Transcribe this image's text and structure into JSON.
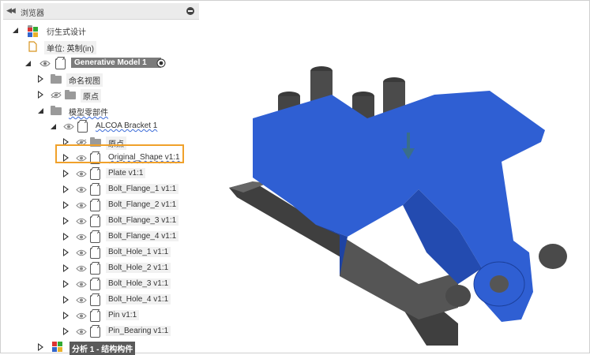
{
  "browser": {
    "collapse_glyph": "◀◀",
    "title": "浏览器",
    "root": "衍生式设计",
    "units": "单位: 英制(in)",
    "model": "Generative Model 1",
    "items": [
      {
        "label": "命名视图",
        "indent": 2
      },
      {
        "label": "原点",
        "indent": 2
      },
      {
        "label": "模型零部件",
        "indent": 2
      },
      {
        "label": "ALCOA Bracket 1",
        "indent": 3
      },
      {
        "label": "原点",
        "indent": 4
      },
      {
        "label": "Original_Shape v1:1",
        "indent": 4
      },
      {
        "label": "Plate v1:1",
        "indent": 4
      },
      {
        "label": "Bolt_Flange_1 v1:1",
        "indent": 4
      },
      {
        "label": "Bolt_Flange_2 v1:1",
        "indent": 4
      },
      {
        "label": "Bolt_Flange_3 v1:1",
        "indent": 4
      },
      {
        "label": "Bolt_Flange_4 v1:1",
        "indent": 4
      },
      {
        "label": "Bolt_Hole_1 v1:1",
        "indent": 4
      },
      {
        "label": "Bolt_Hole_2 v1:1",
        "indent": 4
      },
      {
        "label": "Bolt_Hole_3 v1:1",
        "indent": 4
      },
      {
        "label": "Bolt_Hole_4 v1:1",
        "indent": 4
      },
      {
        "label": "Pin v1:1",
        "indent": 4
      },
      {
        "label": "Pin_Bearing v1:1",
        "indent": 4
      }
    ],
    "study": "分析 1 - 结构构件"
  },
  "colors": {
    "highlight": "#f0a12a",
    "obstacle_blue": "#2f5fd3",
    "gray_part": "#4a4a4a",
    "link_wave": "#3b6bd8"
  }
}
